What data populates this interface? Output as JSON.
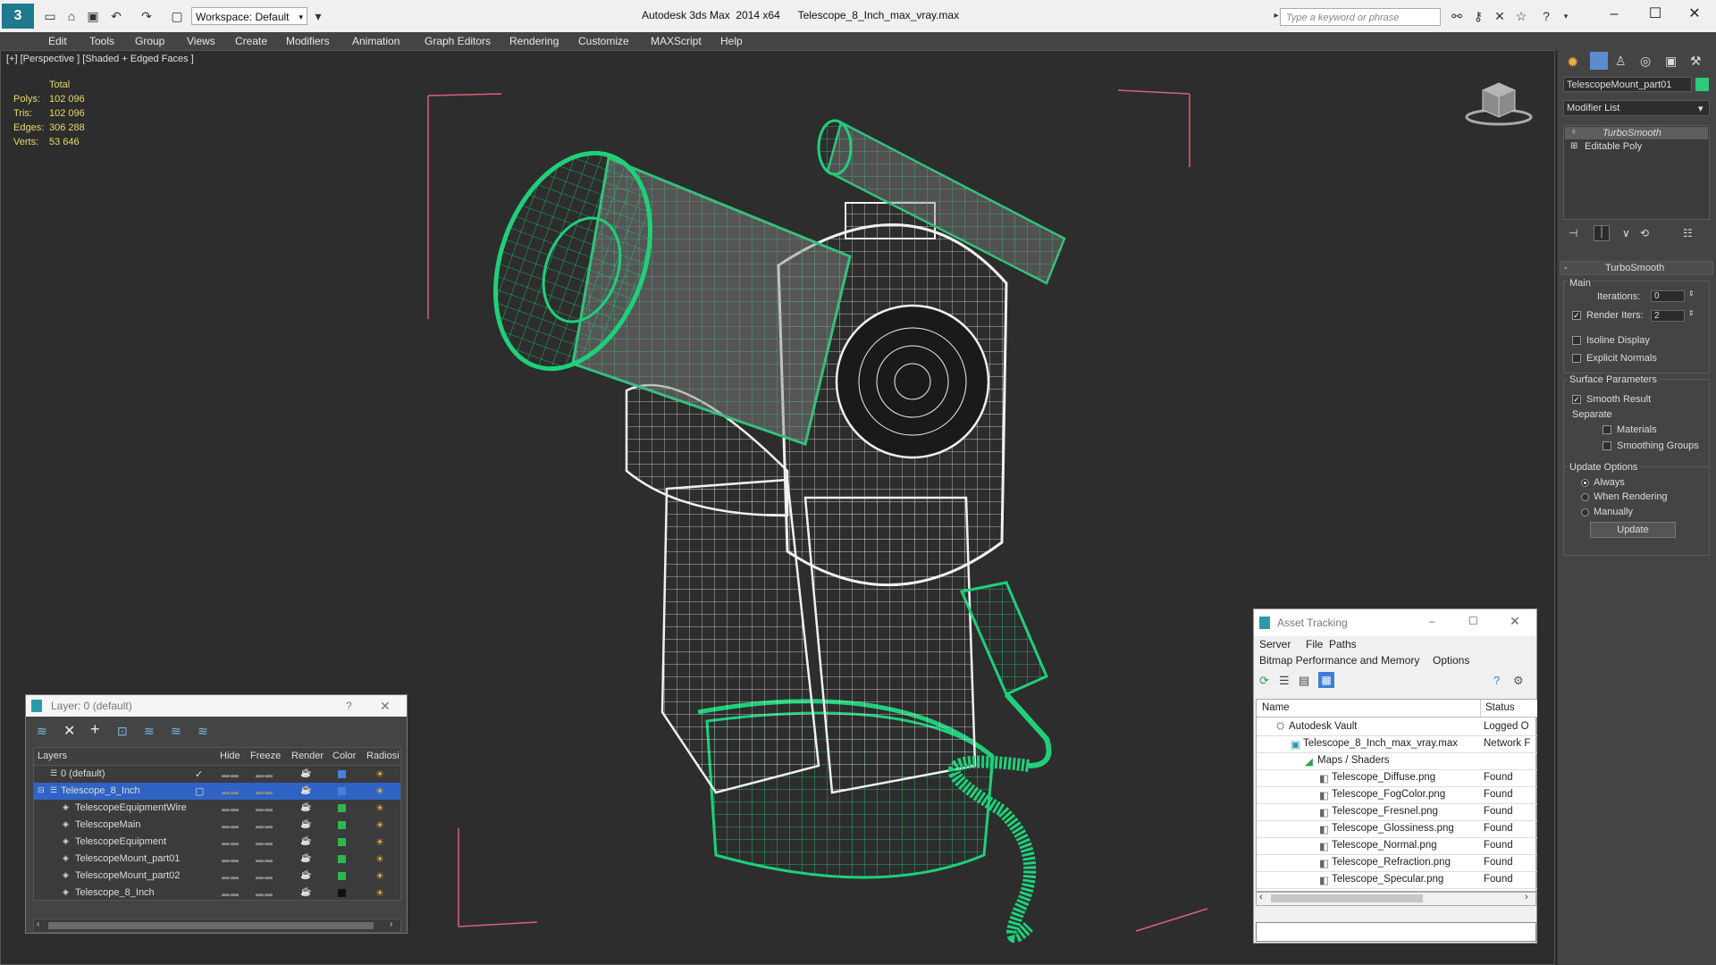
{
  "titlebar": {
    "workspace": "Workspace: Default",
    "app_title": "Autodesk 3ds Max  2014 x64",
    "file_title": "Telescope_8_Inch_max_vray.max",
    "search_placeholder": "Type a keyword or phrase"
  },
  "menu": [
    "Edit",
    "Tools",
    "Group",
    "Views",
    "Create",
    "Modifiers",
    "Animation",
    "Graph Editors",
    "Rendering",
    "Customize",
    "MAXScript",
    "Help"
  ],
  "viewport": {
    "label": "[+] [Perspective ] [Shaded + Edged Faces ]",
    "stats": {
      "total_label": "Total",
      "rows": [
        {
          "k": "Polys:",
          "v": "102 096"
        },
        {
          "k": "Tris:",
          "v": "102 096"
        },
        {
          "k": "Edges:",
          "v": "306 288"
        },
        {
          "k": "Verts:",
          "v": "53 646"
        }
      ]
    },
    "wire_color": "#1fd07a"
  },
  "command_panel": {
    "object_name": "TelescopeMount_part01",
    "object_color": "#2fc97a",
    "modifier_list": "Modifier List",
    "stack": [
      "TurboSmooth",
      "Editable Poly"
    ],
    "rollout_title": "TurboSmooth",
    "main_label": "Main",
    "iterations_label": "Iterations:",
    "iterations_value": "0",
    "render_iters_label": "Render Iters:",
    "render_iters_value": "2",
    "isoline": "Isoline Display",
    "explicit_normals": "Explicit Normals",
    "surface_params": "Surface Parameters",
    "smooth_result": "Smooth Result",
    "separate": "Separate",
    "materials": "Materials",
    "smoothing_groups": "Smoothing Groups",
    "update_options": "Update Options",
    "always": "Always",
    "when_rendering": "When Rendering",
    "manually": "Manually",
    "update_btn": "Update"
  },
  "layer_panel": {
    "title": "Layer: 0 (default)",
    "help": "?",
    "columns": [
      "Layers",
      "Hide",
      "Freeze",
      "Render",
      "Color",
      "Radiosi"
    ],
    "rows": [
      {
        "name": "0 (default)",
        "color": "#4a7fd6",
        "indent": 1
      },
      {
        "name": "Telescope_8_Inch",
        "color": "#4a7fd6",
        "indent": 1
      },
      {
        "name": "TelescopeEquipmentWire",
        "color": "#2eb84a",
        "indent": 2
      },
      {
        "name": "TelescopeMain",
        "color": "#2eb84a",
        "indent": 2
      },
      {
        "name": "TelescopeEquipment",
        "color": "#2eb84a",
        "indent": 2
      },
      {
        "name": "TelescopeMount_part01",
        "color": "#2eb84a",
        "indent": 2
      },
      {
        "name": "TelescopeMount_part02",
        "color": "#2eb84a",
        "indent": 2
      },
      {
        "name": "Telescope_8_Inch",
        "color": "#111111",
        "indent": 2
      }
    ]
  },
  "asset_panel": {
    "title": "Asset Tracking",
    "menu1": [
      "Server",
      "File",
      "Paths"
    ],
    "menu2": [
      "Bitmap Performance and Memory",
      "Options"
    ],
    "col_name": "Name",
    "col_status": "Status",
    "rows": [
      {
        "name": "Autodesk Vault",
        "status": "Logged O",
        "indent": 1
      },
      {
        "name": "Telescope_8_Inch_max_vray.max",
        "status": "Network F",
        "indent": 2
      },
      {
        "name": "Maps / Shaders",
        "status": "",
        "indent": 3
      },
      {
        "name": "Telescope_Diffuse.png",
        "status": "Found",
        "indent": 4
      },
      {
        "name": "Telescope_FogColor.png",
        "status": "Found",
        "indent": 4
      },
      {
        "name": "Telescope_Fresnel.png",
        "status": "Found",
        "indent": 4
      },
      {
        "name": "Telescope_Glossiness.png",
        "status": "Found",
        "indent": 4
      },
      {
        "name": "Telescope_Normal.png",
        "status": "Found",
        "indent": 4
      },
      {
        "name": "Telescope_Refraction.png",
        "status": "Found",
        "indent": 4
      },
      {
        "name": "Telescope_Specular.png",
        "status": "Found",
        "indent": 4
      }
    ]
  }
}
